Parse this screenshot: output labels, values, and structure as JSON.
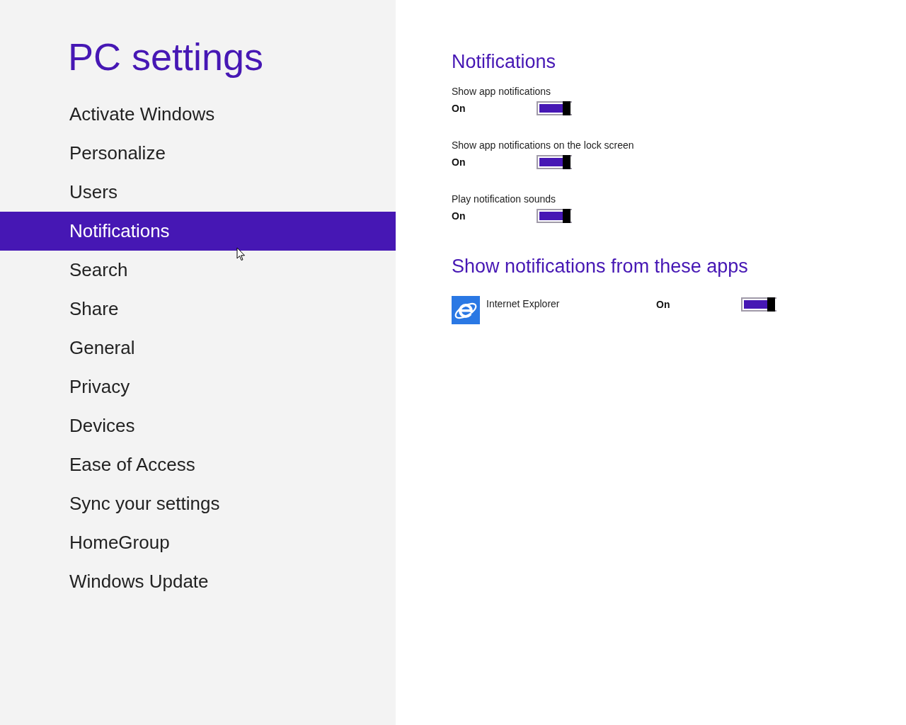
{
  "sidebar": {
    "title": "PC settings",
    "items": [
      {
        "label": "Activate Windows",
        "selected": false
      },
      {
        "label": "Personalize",
        "selected": false
      },
      {
        "label": "Users",
        "selected": false
      },
      {
        "label": "Notifications",
        "selected": true
      },
      {
        "label": "Search",
        "selected": false
      },
      {
        "label": "Share",
        "selected": false
      },
      {
        "label": "General",
        "selected": false
      },
      {
        "label": "Privacy",
        "selected": false
      },
      {
        "label": "Devices",
        "selected": false
      },
      {
        "label": "Ease of Access",
        "selected": false
      },
      {
        "label": "Sync your settings",
        "selected": false
      },
      {
        "label": "HomeGroup",
        "selected": false
      },
      {
        "label": "Windows Update",
        "selected": false
      }
    ]
  },
  "content": {
    "heading": "Notifications",
    "settings": [
      {
        "label": "Show app notifications",
        "state_text": "On",
        "on": true
      },
      {
        "label": "Show app notifications on the lock screen",
        "state_text": "On",
        "on": true
      },
      {
        "label": "Play notification sounds",
        "state_text": "On",
        "on": true
      }
    ],
    "apps_heading": "Show notifications from these apps",
    "apps": [
      {
        "name": "Internet Explorer",
        "state_text": "On",
        "on": true
      }
    ]
  }
}
